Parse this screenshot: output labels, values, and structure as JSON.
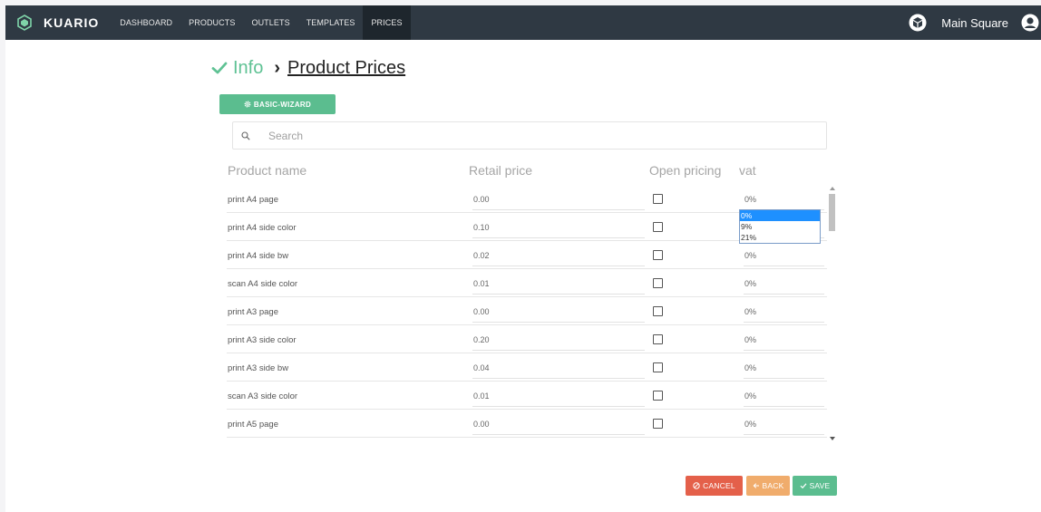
{
  "navbar": {
    "brand": "KUARIO",
    "items": [
      "DASHBOARD",
      "PRODUCTS",
      "OUTLETS",
      "TEMPLATES",
      "PRICES"
    ],
    "active_item": "PRICES",
    "outlet_name": "Main Square",
    "icons": {
      "logo": "kuario-logo-icon",
      "outlet": "cube-icon",
      "user": "user-icon"
    }
  },
  "breadcrumb": {
    "step": "Info",
    "separator": "›",
    "current": "Product Prices"
  },
  "wizard_button": {
    "label": "BASIC-WIZARD",
    "icon": "gear-icon"
  },
  "search": {
    "placeholder": "Search",
    "value": ""
  },
  "table": {
    "columns": [
      "Product name",
      "Retail price",
      "Open pricing",
      "vat"
    ],
    "rows": [
      {
        "name": "print A4 page",
        "price": "0.00",
        "open_pricing": false,
        "vat": "0%"
      },
      {
        "name": "print A4 side color",
        "price": "0.10",
        "open_pricing": false,
        "vat": "0%"
      },
      {
        "name": "print A4 side bw",
        "price": "0.02",
        "open_pricing": false,
        "vat": "0%"
      },
      {
        "name": "scan A4 side color",
        "price": "0.01",
        "open_pricing": false,
        "vat": "0%"
      },
      {
        "name": "print A3 page",
        "price": "0.00",
        "open_pricing": false,
        "vat": "0%"
      },
      {
        "name": "print A3 side color",
        "price": "0.20",
        "open_pricing": false,
        "vat": "0%"
      },
      {
        "name": "print A3 side bw",
        "price": "0.04",
        "open_pricing": false,
        "vat": "0%"
      },
      {
        "name": "scan A3 side color",
        "price": "0.01",
        "open_pricing": false,
        "vat": "0%"
      },
      {
        "name": "print A5 page",
        "price": "0.00",
        "open_pricing": false,
        "vat": "0%"
      }
    ]
  },
  "vat_dropdown": {
    "options": [
      "0%",
      "9%",
      "21%"
    ],
    "selected": "0%",
    "open_row": 1
  },
  "footer": {
    "cancel": "CANCEL",
    "back": "BACK",
    "save": "SAVE"
  },
  "colors": {
    "navbar": "#2f3943",
    "accent_green": "#5bbd8f",
    "cancel_red": "#e4604a",
    "back_orange": "#f0ac6c",
    "dropdown_selected": "#1e90ff"
  }
}
